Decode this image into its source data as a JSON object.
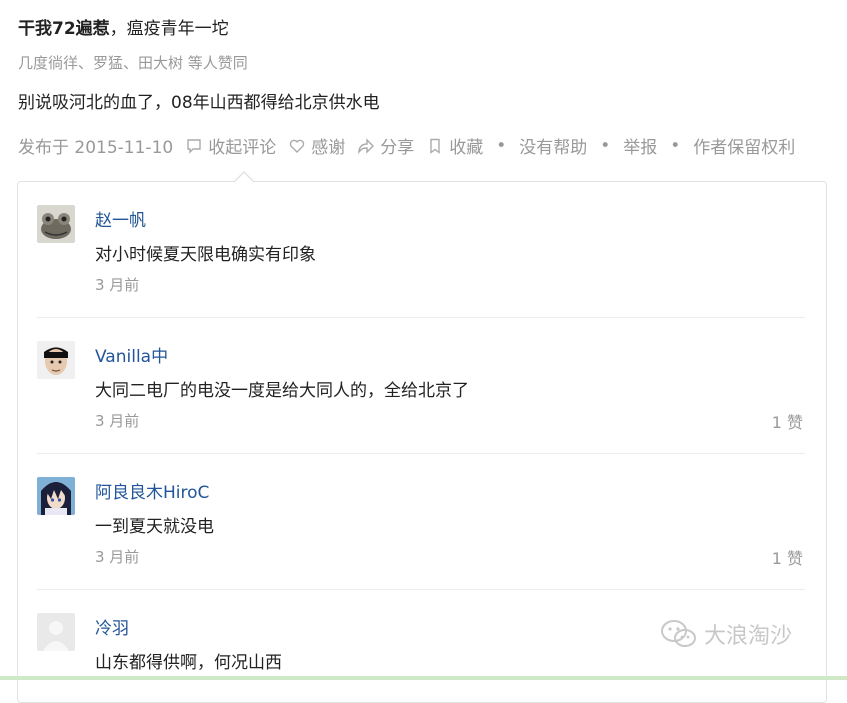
{
  "answer": {
    "author_name": "干我72遍惹",
    "author_bio": "，瘟疫青年一坨",
    "voters_text": "几度徜徉、罗猛、田大树 等人赞同",
    "content": "别说吸河北的血了，08年山西都得给北京供水电"
  },
  "actions": {
    "published": "发布于 2015-11-10",
    "collapse_comments": "收起评论",
    "thanks": "感谢",
    "share": "分享",
    "collect": "收藏",
    "dot": "•",
    "no_help": "没有帮助",
    "report": "举报",
    "copyright": "作者保留权利"
  },
  "comments": [
    {
      "name": "赵一帆",
      "text": "对小时候夏天限电确实有印象",
      "time": "3 月前",
      "likes": ""
    },
    {
      "name": "Vanilla中",
      "text": "大同二电厂的电没一度是给大同人的，全给北京了",
      "time": "3 月前",
      "likes": "1 赞"
    },
    {
      "name": "阿良良木HiroC",
      "text": "一到夏天就没电",
      "time": "3 月前",
      "likes": "1 赞"
    },
    {
      "name": "冷羽",
      "text": "山东都得供啊，何况山西",
      "time": "",
      "likes": ""
    }
  ],
  "watermark": "大浪淘沙",
  "colors": {
    "link": "#225599",
    "muted": "#999999"
  }
}
